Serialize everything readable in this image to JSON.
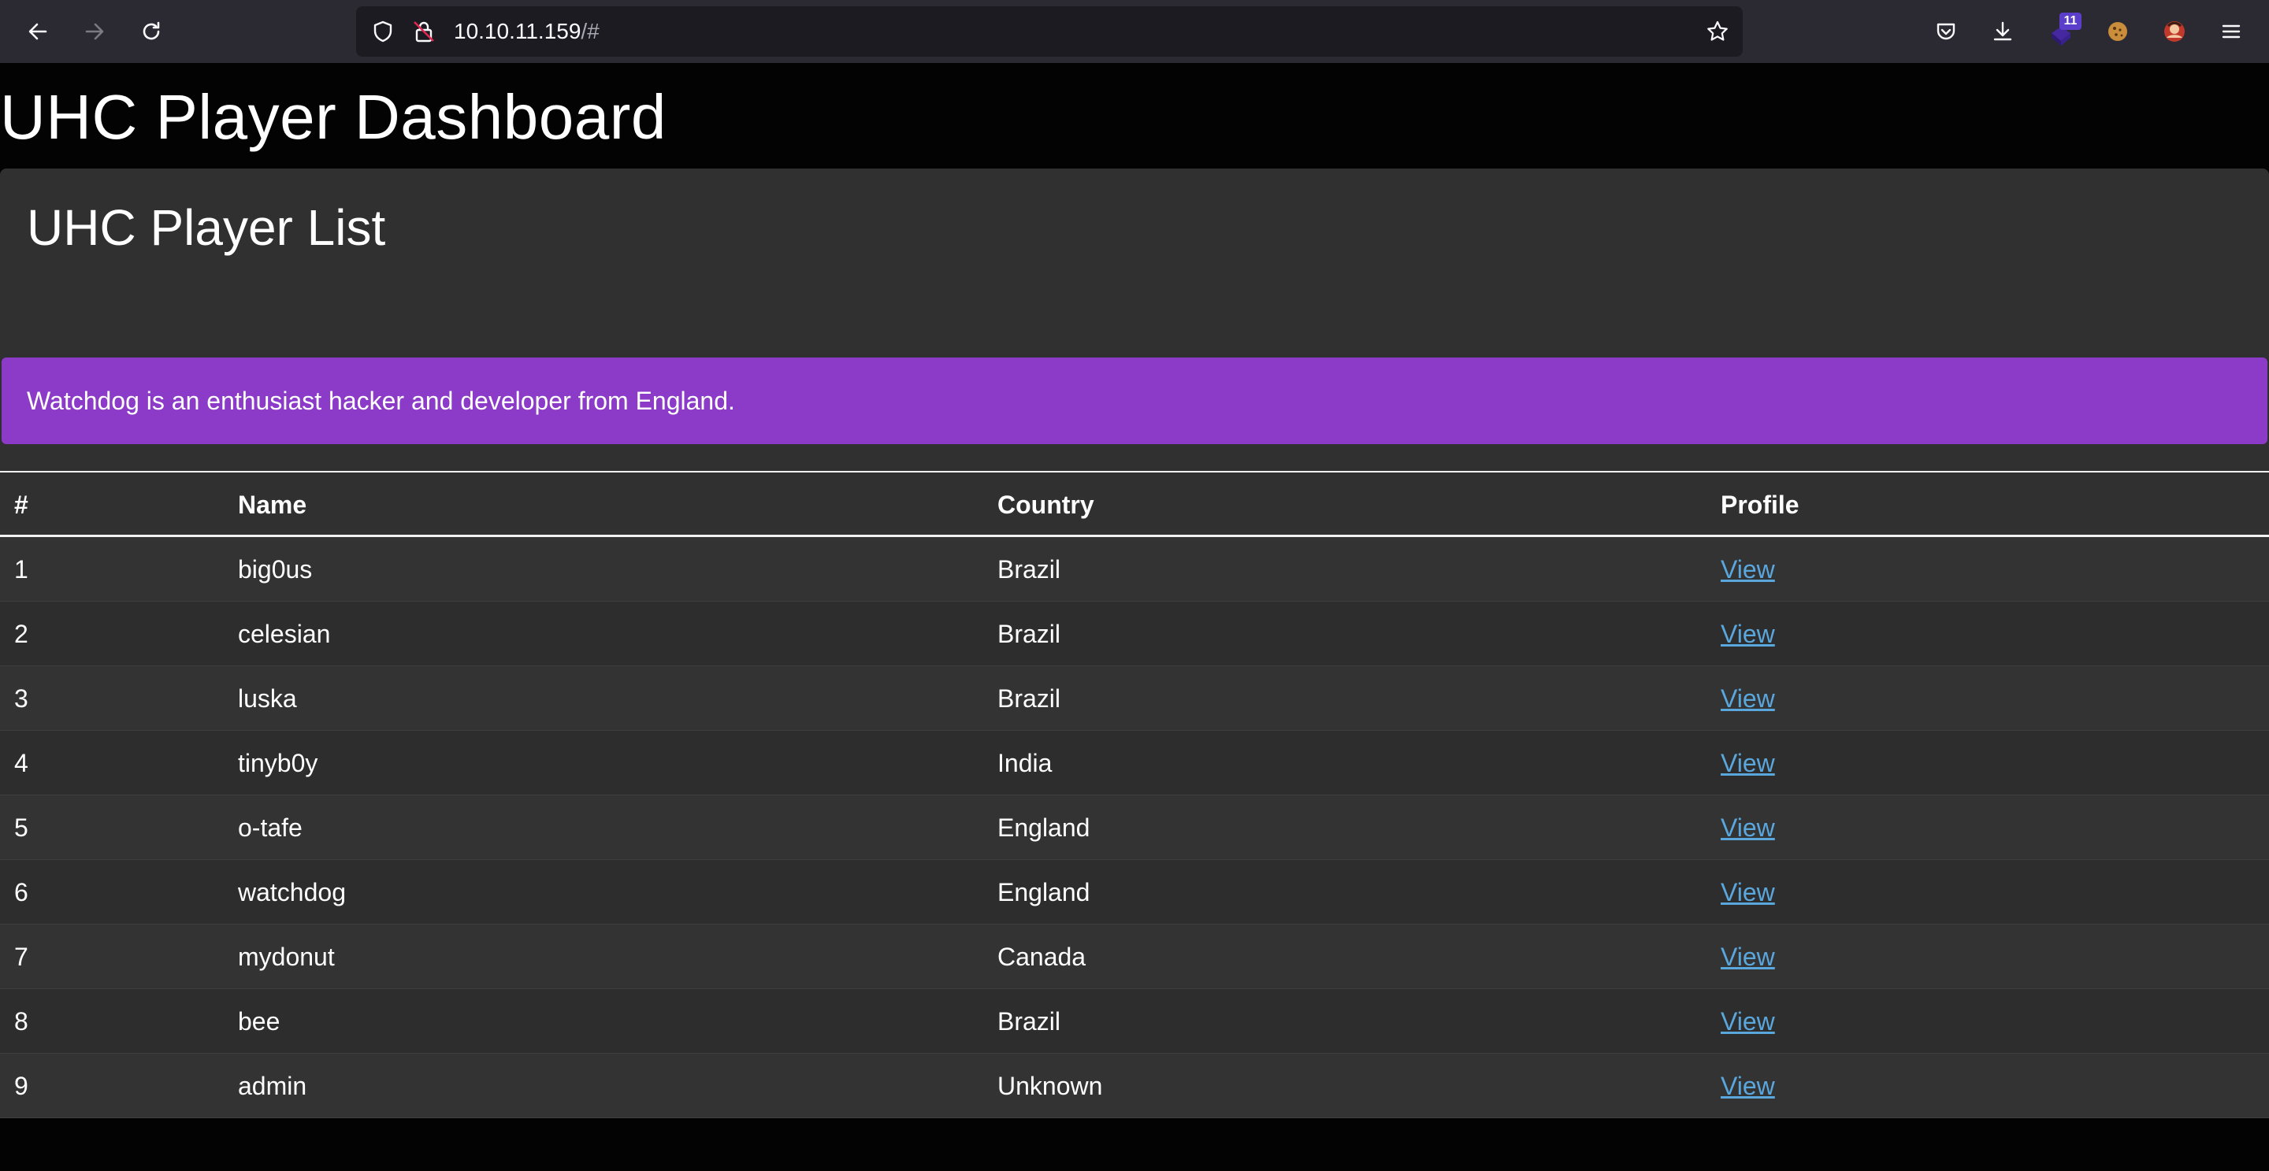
{
  "browser": {
    "url_host": "10.10.11.159",
    "url_rest": "/#",
    "extension_badge": "11"
  },
  "page": {
    "title": "UHC Player Dashboard",
    "card_title": "UHC Player List",
    "alert_text": "Watchdog is an enthusiast hacker and developer from England."
  },
  "table": {
    "headers": {
      "num": "#",
      "name": "Name",
      "country": "Country",
      "profile": "Profile"
    },
    "rows": [
      {
        "num": "1",
        "name": "big0us",
        "country": "Brazil",
        "profile": "View"
      },
      {
        "num": "2",
        "name": "celesian",
        "country": "Brazil",
        "profile": "View"
      },
      {
        "num": "3",
        "name": "luska",
        "country": "Brazil",
        "profile": "View"
      },
      {
        "num": "4",
        "name": "tinyb0y",
        "country": "India",
        "profile": "View"
      },
      {
        "num": "5",
        "name": "o-tafe",
        "country": "England",
        "profile": "View"
      },
      {
        "num": "6",
        "name": "watchdog",
        "country": "England",
        "profile": "View"
      },
      {
        "num": "7",
        "name": "mydonut",
        "country": "Canada",
        "profile": "View"
      },
      {
        "num": "8",
        "name": "bee",
        "country": "Brazil",
        "profile": "View"
      },
      {
        "num": "9",
        "name": "admin",
        "country": "Unknown",
        "profile": "View"
      }
    ]
  },
  "colors": {
    "toolbar": "#2b2a33",
    "urlbar": "#1c1b22",
    "page_bg": "#030303",
    "card_bg": "#303030",
    "alert_bg": "#8b3bc7",
    "link": "#5aa7dd"
  },
  "icons": [
    "back-arrow-icon",
    "forward-arrow-icon",
    "reload-icon",
    "shield-icon",
    "insecure-lock-icon",
    "bookmark-star-icon",
    "pocket-icon",
    "download-icon",
    "extension-icon",
    "cookie-icon",
    "avatar-icon",
    "hamburger-menu-icon"
  ]
}
